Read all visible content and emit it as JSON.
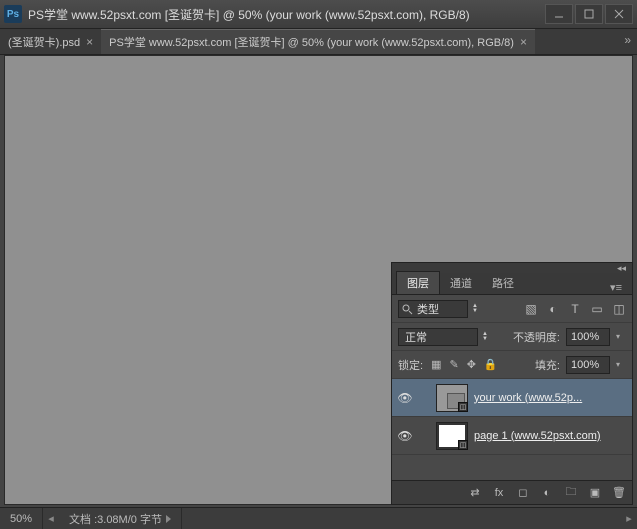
{
  "titlebar": {
    "logo_text": "Ps",
    "title": "PS学堂 www.52psxt.com [圣诞贺卡] @ 50% (your work (www.52psxt.com), RGB/8)"
  },
  "tabs": [
    {
      "label": "(圣诞贺卡).psd",
      "active": false
    },
    {
      "label": "PS学堂 www.52psxt.com [圣诞贺卡] @ 50% (your work (www.52psxt.com), RGB/8)",
      "active": true
    }
  ],
  "statusbar": {
    "zoom": "50%",
    "doc_info": "文档 :3.08M/0 字节"
  },
  "layers_panel": {
    "tabs": {
      "layers": "图层",
      "channels": "通道",
      "paths": "路径"
    },
    "filter_label": "类型",
    "blend_mode": "正常",
    "opacity_label": "不透明度:",
    "opacity_value": "100%",
    "lock_label": "锁定:",
    "fill_label": "填充:",
    "fill_value": "100%",
    "layers": [
      {
        "name": "your work (www.52p...",
        "selected": true
      },
      {
        "name": "page 1 (www.52psxt.com)",
        "selected": false
      }
    ]
  }
}
